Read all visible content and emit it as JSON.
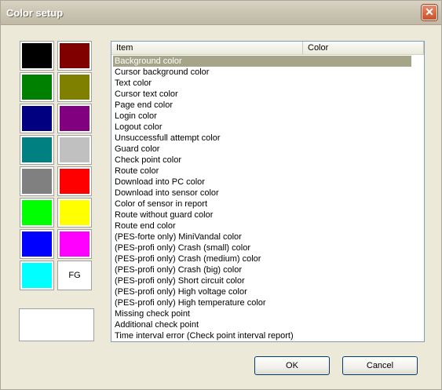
{
  "window": {
    "title": "Color setup"
  },
  "swatches": [
    {
      "color": "#000000"
    },
    {
      "color": "#800000"
    },
    {
      "color": "#008000"
    },
    {
      "color": "#808000"
    },
    {
      "color": "#000080"
    },
    {
      "color": "#800080"
    },
    {
      "color": "#008080"
    },
    {
      "color": "#c0c0c0"
    },
    {
      "color": "#808080"
    },
    {
      "color": "#ff0000"
    },
    {
      "color": "#00ff00"
    },
    {
      "color": "#ffff00"
    },
    {
      "color": "#0000ff"
    },
    {
      "color": "#ff00ff"
    },
    {
      "color": "#00ffff"
    },
    {
      "color": "#ffffff",
      "label": "FG"
    }
  ],
  "preview": {
    "color": "#ffffff"
  },
  "list": {
    "columns": [
      "Item",
      "Color"
    ],
    "selected_index": 0,
    "items": [
      "Background color",
      "Cursor background color",
      "Text color",
      "Cursor text color",
      "Page end color",
      "Login color",
      "Logout color",
      "Unsuccessfull attempt color",
      "Guard color",
      "Check point color",
      "Route color",
      "Download into PC color",
      "Download into sensor color",
      "Color of sensor in report",
      "Route without guard color",
      "Route end color",
      "(PES-forte only) MiniVandal color",
      "(PES-profi only) Crash (small) color",
      "(PES-profi only) Crash (medium) color",
      "(PES-profi only) Crash (big) color",
      "(PES-profi only) Short circuit color",
      "(PES-profi only) High voltage color",
      "(PES-profi only) High temperature color",
      "Missing check point",
      "Additional check point",
      "Time interval error (Check point interval report)"
    ]
  },
  "buttons": {
    "ok": "OK",
    "cancel": "Cancel"
  }
}
